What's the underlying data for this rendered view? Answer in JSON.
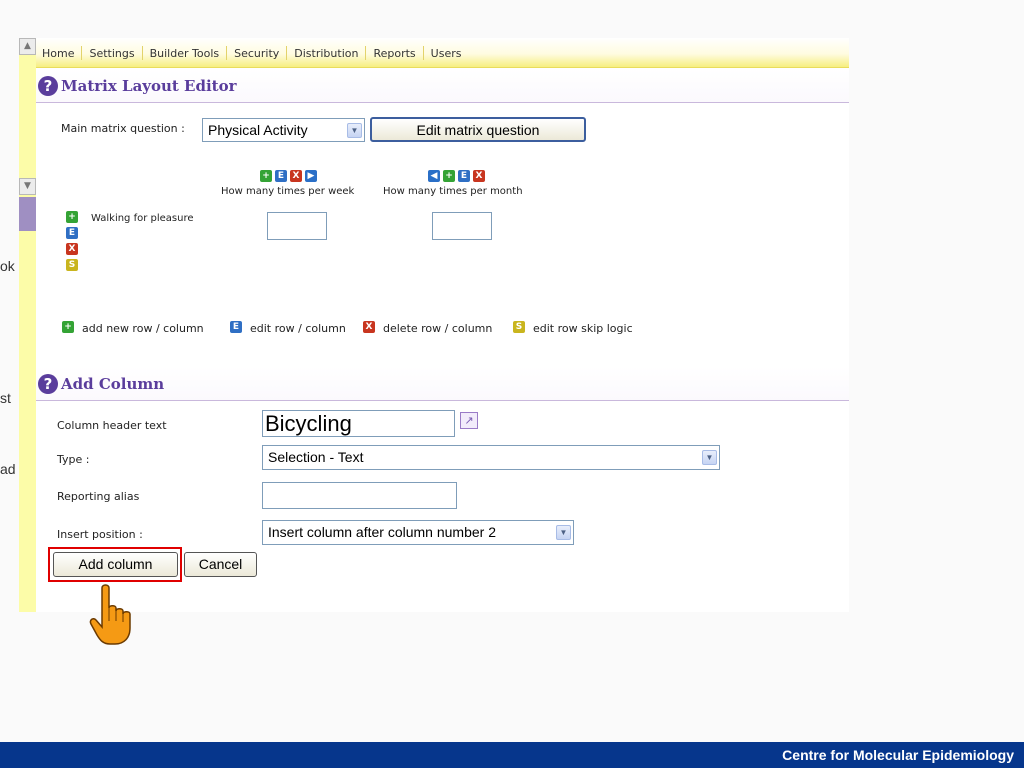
{
  "nav": {
    "items": [
      "Home",
      "Settings",
      "Builder Tools",
      "Security",
      "Distribution",
      "Reports",
      "Users"
    ]
  },
  "left_fragments": [
    "ok",
    "st",
    "ad"
  ],
  "matrix_editor": {
    "title": "Matrix Layout Editor",
    "main_question_label": "Main matrix question :",
    "main_question_value": "Physical Activity",
    "edit_button": "Edit matrix question",
    "columns": [
      "How many times per week",
      "How many times per month"
    ],
    "rows": [
      "Walking for pleasure"
    ],
    "col1_icons": [
      "+",
      "E",
      "X",
      "▶"
    ],
    "col2_icons": [
      "◀",
      "+",
      "E",
      "X"
    ],
    "row_icons": [
      "+",
      "E",
      "X",
      "S"
    ]
  },
  "legend": {
    "add": "add new row / column",
    "edit": "edit row / column",
    "delete": "delete row / column",
    "skip": "edit row skip logic"
  },
  "add_column": {
    "title": "Add Column",
    "header_label": "Column header text",
    "header_value": "Bicycling",
    "type_label": "Type :",
    "type_value": "Selection - Text",
    "alias_label": "Reporting alias",
    "alias_value": "",
    "position_label": "Insert position :",
    "position_value": "Insert column after column number 2",
    "add_button": "Add column",
    "cancel_button": "Cancel"
  },
  "footer": {
    "text": "Centre for Molecular Epidemiology"
  },
  "colors": {
    "accent": "#5a3d9c",
    "highlight": "#e00000",
    "footer": "#06368c",
    "nav_bg": "#fffce0"
  }
}
